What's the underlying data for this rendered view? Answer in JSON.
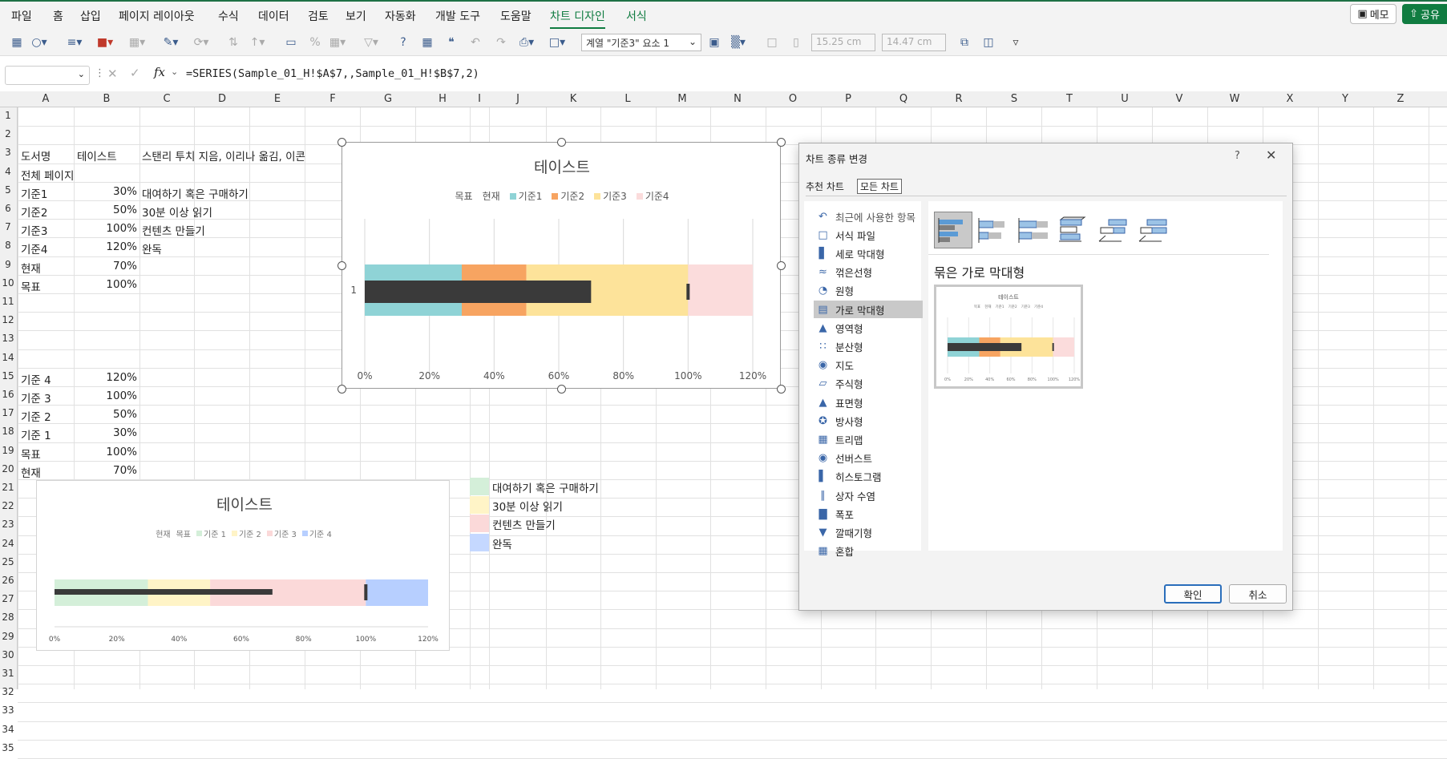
{
  "ribbon": {
    "tabs": [
      "파일",
      "홈",
      "삽입",
      "페이지 레이아웃",
      "수식",
      "데이터",
      "검토",
      "보기",
      "자동화",
      "개발 도구",
      "도움말",
      "차트 디자인",
      "서식"
    ],
    "memo": "메모",
    "share": "공유"
  },
  "toolbar": {
    "series_select": "계열 \"기준3\" 요소 1",
    "height": "15.25 cm",
    "width": "14.47 cm"
  },
  "formula_bar": {
    "name_box": "",
    "fx": "fx",
    "formula": "=SERIES(Sample_01_H!$A$7,,Sample_01_H!$B$7,2)"
  },
  "columns": [
    "A",
    "B",
    "C",
    "D",
    "E",
    "F",
    "G",
    "H",
    "I",
    "J",
    "K",
    "L",
    "M",
    "N",
    "O",
    "P",
    "Q",
    "R",
    "S",
    "T",
    "U",
    "V",
    "W",
    "X",
    "Y",
    "Z"
  ],
  "rows": [
    "1",
    "2",
    "3",
    "4",
    "5",
    "6",
    "7",
    "8",
    "9",
    "10",
    "11",
    "12",
    "13",
    "14",
    "15",
    "16",
    "17",
    "18",
    "19",
    "20",
    "21",
    "22",
    "23",
    "24",
    "25",
    "26",
    "27",
    "28",
    "29",
    "30",
    "31",
    "32",
    "33",
    "34",
    "35"
  ],
  "cells": {
    "a3": "도서명",
    "b3": "테이스트",
    "c3": "스탠리 투치 지음, 이리나 옮김, 이콘",
    "a4": "전체 페이지",
    "a5": "기준1",
    "b5": "30%",
    "c5": "대여하기 혹은 구매하기",
    "a6": "기준2",
    "b6": "50%",
    "c6": "30분 이상 읽기",
    "a7": "기준3",
    "b7": "100%",
    "c7": "컨텐츠 만들기",
    "a8": "기준4",
    "b8": "120%",
    "c8": "완독",
    "a9": "현재",
    "b9": "70%",
    "a10": "목표",
    "b10": "100%",
    "a15": "기준 4",
    "b15": "120%",
    "a16": "기준 3",
    "b16": "100%",
    "a17": "기준 2",
    "b17": "50%",
    "a18": "기준 1",
    "b18": "30%",
    "a19": "목표",
    "b19": "100%",
    "a20": "현재",
    "b20": "70%"
  },
  "legend_side": [
    {
      "label": "대여하기 혹은 구매하기",
      "color": "#d4efd9"
    },
    {
      "label": "30분 이상 읽기",
      "color": "#fff4c7"
    },
    {
      "label": "컨텐츠 만들기",
      "color": "#fbd9d9"
    },
    {
      "label": "완독",
      "color": "#c5d8ff"
    }
  ],
  "chart_data": [
    {
      "type": "bar",
      "orientation": "horizontal",
      "stacked": true,
      "title": "테이스트",
      "categories": [
        "1"
      ],
      "legend": [
        "목표",
        "현재",
        "기준1",
        "기준2",
        "기준3",
        "기준4"
      ],
      "legend_placement": "top",
      "series": [
        {
          "name": "기준1",
          "values": [
            0.3
          ],
          "color": "#8fd3d6"
        },
        {
          "name": "기준2",
          "values": [
            0.5
          ],
          "color": "#f7a461"
        },
        {
          "name": "기준3",
          "values": [
            1.0
          ],
          "color": "#fde39a"
        },
        {
          "name": "기준4",
          "values": [
            1.2
          ],
          "color": "#fbdcdc"
        },
        {
          "name": "현재",
          "values": [
            0.7
          ],
          "color": "#3a3a3a"
        },
        {
          "name": "목표",
          "values": [
            1.0
          ],
          "color": "#3a3a3a"
        }
      ],
      "xlim": [
        0,
        1.2
      ],
      "xticks": [
        "0%",
        "20%",
        "40%",
        "60%",
        "80%",
        "100%",
        "120%"
      ],
      "grid": true
    },
    {
      "type": "bar",
      "orientation": "horizontal",
      "stacked": true,
      "title": "테이스트",
      "legend": [
        "현재",
        "목표",
        "기준 1",
        "기준 2",
        "기준 3",
        "기준 4"
      ],
      "legend_placement": "top",
      "series": [
        {
          "name": "기준 1",
          "values": [
            0.3
          ],
          "color": "#d4efd9"
        },
        {
          "name": "기준 2",
          "values": [
            0.5
          ],
          "color": "#fff4c7"
        },
        {
          "name": "기준 3",
          "values": [
            1.0
          ],
          "color": "#fbd9d9"
        },
        {
          "name": "기준 4",
          "values": [
            1.2
          ],
          "color": "#b7cfff"
        },
        {
          "name": "현재",
          "values": [
            0.7
          ],
          "color": "#3a3a3a"
        },
        {
          "name": "목표",
          "values": [
            1.0
          ],
          "color": "#3a3a3a"
        }
      ],
      "xlim": [
        0,
        1.2
      ],
      "xticks": [
        "0%",
        "20%",
        "40%",
        "60%",
        "80%",
        "100%",
        "120%"
      ],
      "grid": false
    }
  ],
  "dialog": {
    "title": "차트 종류 변경",
    "help": "?",
    "tabs": [
      "추천 차트",
      "모든 차트"
    ],
    "types": [
      "최근에 사용한 항목",
      "서식 파일",
      "세로 막대형",
      "꺾은선형",
      "원형",
      "가로 막대형",
      "영역형",
      "분산형",
      "지도",
      "주식형",
      "표면형",
      "방사형",
      "트리맵",
      "선버스트",
      "히스토그램",
      "상자 수염",
      "폭포",
      "깔때기형",
      "혼합"
    ],
    "selected_type": "가로 막대형",
    "subtype_title": "묶은 가로 막대형",
    "preview_title": "테이스트",
    "preview_legend": [
      "목표",
      "현재",
      "기준1",
      "기준2",
      "기준3",
      "기준4"
    ],
    "preview_ticks": [
      "0%",
      "20%",
      "40%",
      "60%",
      "80%",
      "100%",
      "120%"
    ],
    "ok": "확인",
    "cancel": "취소"
  }
}
